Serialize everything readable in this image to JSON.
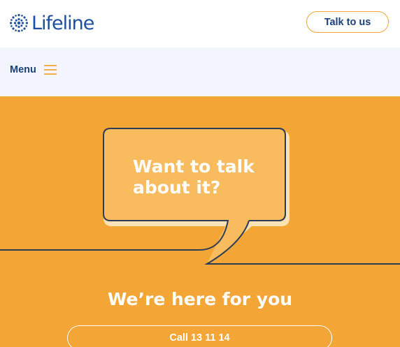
{
  "brand": {
    "name": "Lifeline",
    "logo_icon": "lifeline-dots-icon",
    "color": "#1d4fa0"
  },
  "header": {
    "cta_label": "Talk to us"
  },
  "nav": {
    "menu_label": "Menu",
    "menu_icon": "hamburger-icon"
  },
  "hero": {
    "bubble_line1": "Want to talk",
    "bubble_line2": "about it?",
    "heading": "We’re here for you",
    "call_label": "Call 13 11 14",
    "background": "#f3a536"
  },
  "colors": {
    "accent": "#f3a536",
    "navy": "#1c3f78",
    "nav_bg": "#f2f5fb"
  }
}
